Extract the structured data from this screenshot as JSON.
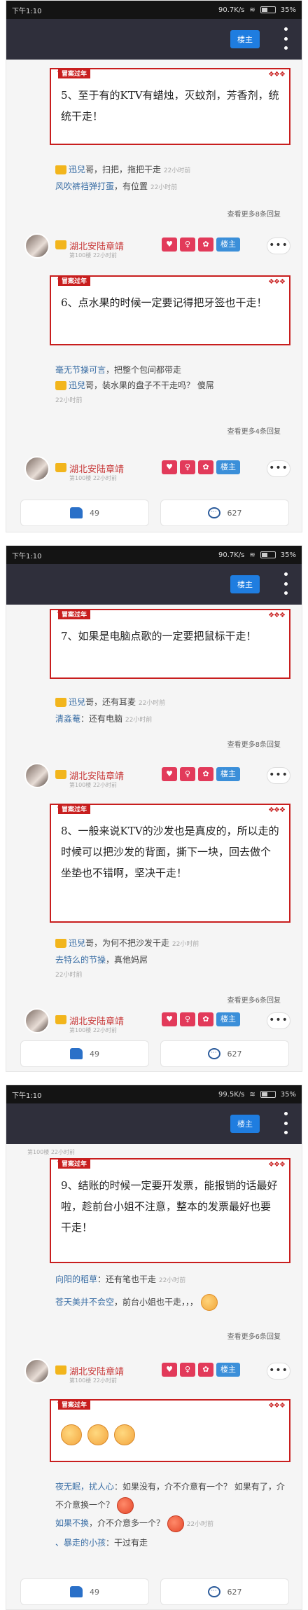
{
  "screens": [
    {
      "status": {
        "time": "下午1:10",
        "speed": "90.7K/s",
        "battery": "35%"
      },
      "louzhu": "楼主",
      "posts": [
        {
          "tag": "冒案过年",
          "text": "5、至于有的KTV有蜡烛，灭蚊剂，芳香剂，统统干走！"
        },
        {
          "tag": "冒案过年",
          "text": "6、点水果的时候一定要记得把牙签也干走！"
        }
      ],
      "replies1": [
        {
          "user": "迅兒",
          "text": "哥，扫把，拖把干走",
          "time": "22小时前"
        },
        {
          "user": "风吹裤裆弹打蛋",
          "text": "，有位置",
          "time": "22小时前"
        }
      ],
      "more1": "查看更多8条回复",
      "replies2": [
        {
          "user": "毫无节操可言",
          "text": "，把整个包间都带走",
          "time": "22小时前"
        },
        {
          "user": "迅兒",
          "text": "哥，装水果的盘子不干走吗？ 傻屌",
          "time": "22小时前"
        }
      ],
      "more2": "查看更多4条回复",
      "user": {
        "name": "湖北安陆章靖",
        "floor": "第100楼",
        "time": "22小时前"
      },
      "badges": [
        "♥",
        "♀",
        "✿",
        "楼主"
      ],
      "like": "49",
      "comment": "627"
    },
    {
      "status": {
        "time": "下午1:10",
        "speed": "90.7K/s",
        "battery": "35%"
      },
      "louzhu": "楼主",
      "posts": [
        {
          "tag": "冒案过年",
          "text": "7、如果是电脑点歌的一定要把鼠标干走！"
        },
        {
          "tag": "冒案过年",
          "text": "8、一般来说KTV的沙发也是真皮的，所以走的时候可以把沙发的背面，撕下一块，回去做个坐垫也不错啊，坚决干走！"
        }
      ],
      "replies1": [
        {
          "user": "迅兒",
          "text": "哥，还有耳麦",
          "time": "22小时前"
        },
        {
          "user": "清淼菴",
          "text": "：还有电脑",
          "time": "22小时前"
        }
      ],
      "more1": "查看更多8条回复",
      "replies2": [
        {
          "user": "迅兒",
          "text": "哥，为何不把沙发干走",
          "time": "22小时前"
        },
        {
          "user": "去特么的节操",
          "text": "，真他妈屌",
          "time": "22小时前"
        }
      ],
      "more2": "查看更多6条回复",
      "user": {
        "name": "湖北安陆章靖",
        "floor": "第100楼",
        "time": "22小时前"
      },
      "badges": [
        "♥",
        "♀",
        "✿",
        "楼主"
      ],
      "like": "49",
      "comment": "627"
    },
    {
      "status": {
        "time": "下午1:10",
        "speed": "99.5K/s",
        "battery": "35%"
      },
      "louzhu": "楼主",
      "posts": [
        {
          "tag": "冒案过年",
          "text": "9、结账的时候一定要开发票，能报销的话最好啦，趁前台小姐不注意，整本的发票最好也要干走！"
        },
        {
          "tag": "冒案过年",
          "text": ""
        }
      ],
      "replies1": [
        {
          "user": "向阳的稻草",
          "text": "：还有笔也干走",
          "time": "22小时前"
        },
        {
          "user": "苍天美井不会空",
          "text": "，前台小姐也干走，，，",
          "time": ""
        }
      ],
      "more1": "查看更多6条回复",
      "replies2": [
        {
          "user": "夜无眠，扰人心",
          "text": "：如果没有，介不介意有一个？ 如果有了，介不介意换一个？",
          "time": ""
        },
        {
          "user": "如果不换",
          "text": "，介不介意多一个？",
          "time": "22小时前"
        },
        {
          "user": "、暴走的小孩",
          "text": "：干过有走",
          "time": ""
        }
      ],
      "more2": "",
      "user": {
        "name": "湖北安陆章靖",
        "floor": "第100楼",
        "time": "22小时前"
      },
      "badges": [
        "♥",
        "♀",
        "✿",
        "楼主"
      ],
      "like": "49",
      "comment": "627"
    }
  ]
}
